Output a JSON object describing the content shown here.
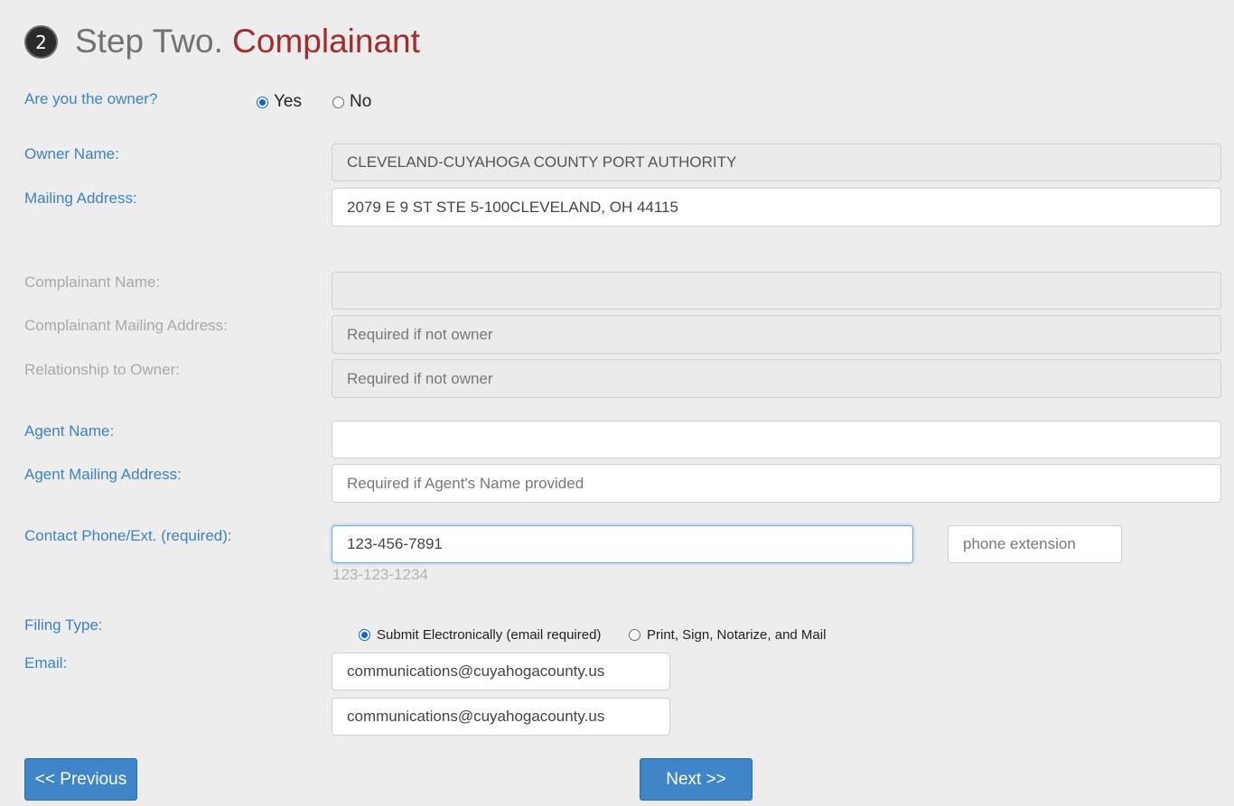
{
  "header": {
    "step_number": "2",
    "title_prefix": "Step Two.",
    "title_accent": "Complainant"
  },
  "owner_question": {
    "label": "Are you the owner?",
    "options": [
      {
        "label": "Yes",
        "checked": true
      },
      {
        "label": "No",
        "checked": false
      }
    ]
  },
  "owner_name": {
    "label": "Owner Name:",
    "value": "CLEVELAND-CUYAHOGA COUNTY PORT AUTHORITY"
  },
  "mailing_address": {
    "label": "Mailing Address:",
    "value": "2079 E 9 ST STE 5-100CLEVELAND, OH 44115"
  },
  "complainant_name": {
    "label": "Complainant Name:",
    "value": "",
    "placeholder": ""
  },
  "complainant_mailing_address": {
    "label": "Complainant Mailing Address:",
    "placeholder": "Required if not owner"
  },
  "relationship_to_owner": {
    "label": "Relationship to Owner:",
    "placeholder": "Required if not owner"
  },
  "agent_name": {
    "label": "Agent Name:",
    "value": ""
  },
  "agent_mailing_address": {
    "label": "Agent Mailing Address:",
    "placeholder": "Required if Agent's Name provided"
  },
  "contact_phone": {
    "label": "Contact Phone/Ext. (required):",
    "value": "123-456-7891",
    "hint": "123-123-1234",
    "extension_placeholder": "phone extension"
  },
  "filing_type": {
    "label": "Filing Type:",
    "options": [
      {
        "label": "Submit Electronically (email required)",
        "checked": true
      },
      {
        "label": "Print, Sign, Notarize, and Mail",
        "checked": false
      }
    ]
  },
  "email": {
    "label": "Email:",
    "value": "communications@cuyahogacounty.us",
    "confirm_value": "communications@cuyahogacounty.us"
  },
  "navigation": {
    "previous_label": "<< Previous",
    "next_label": "Next >>"
  },
  "colors": {
    "label_blue": "#3c83c5",
    "accent_red": "#a42c2c",
    "button_blue": "#3f86c9",
    "background": "#ededed"
  }
}
